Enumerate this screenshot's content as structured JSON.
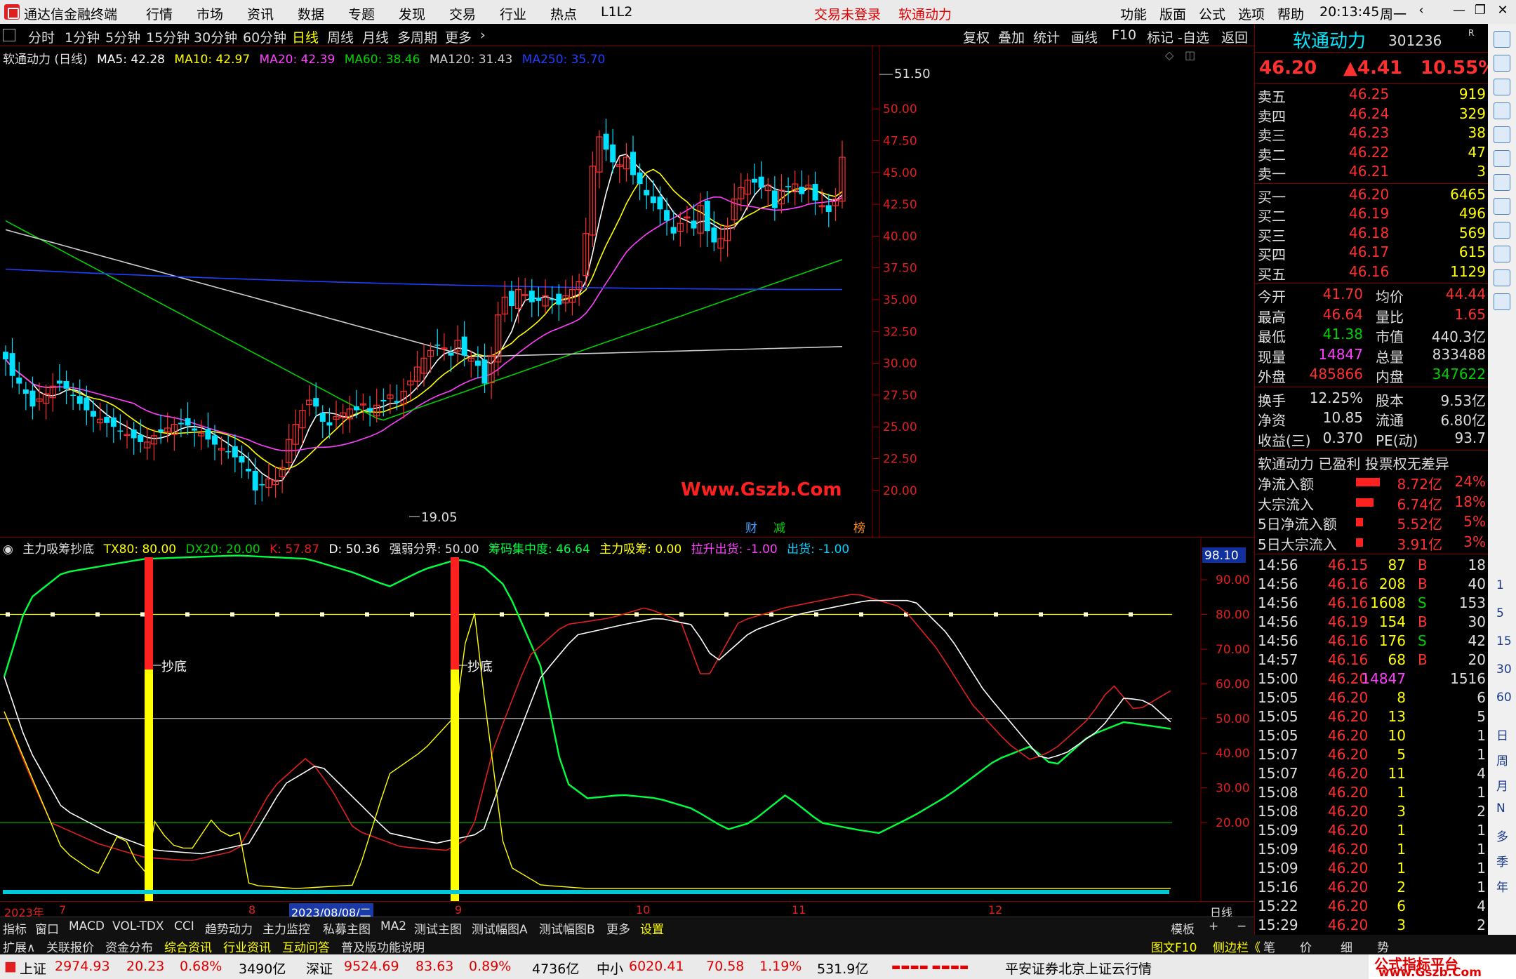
{
  "titlebar": {
    "app_name": "通达信金融终端",
    "menus": [
      "行情",
      "市场",
      "资讯",
      "数据",
      "专题",
      "发现",
      "交易",
      "行业",
      "热点",
      "L1L2"
    ],
    "login_status": "交易未登录",
    "stock_name": "软通动力",
    "right_menus": [
      "功能",
      "版面",
      "公式",
      "选项",
      "帮助"
    ],
    "time": "20:13:45",
    "weekday": "周一"
  },
  "periodbar": {
    "periods": [
      "分时",
      "1分钟",
      "5分钟",
      "15分钟",
      "30分钟",
      "60分钟",
      "日线",
      "周线",
      "月线",
      "多周期",
      "更多"
    ],
    "active": "日线",
    "tools": [
      "复权",
      "叠加",
      "统计",
      "画线",
      "F10",
      "标记",
      "-自选",
      "返回"
    ]
  },
  "main_chart": {
    "legend_title": "软通动力 (日线)",
    "ma": [
      {
        "label": "MA5: 42.28",
        "color": "#ffffff"
      },
      {
        "label": "MA10: 42.97",
        "color": "#ffff00"
      },
      {
        "label": "MA20: 42.39",
        "color": "#ff40ff"
      },
      {
        "label": "MA60: 38.46",
        "color": "#00d000"
      },
      {
        "label": "MA120: 31.43",
        "color": "#cccccc"
      },
      {
        "label": "MA250: 35.70",
        "color": "#2040ff"
      }
    ],
    "y_ticks": [
      "50.00",
      "47.50",
      "45.00",
      "42.50",
      "40.00",
      "37.50",
      "35.00",
      "32.50",
      "30.00",
      "27.50",
      "25.00",
      "22.50",
      "20.00"
    ],
    "high_label": "51.50",
    "low_label": "19.05",
    "watermark": "Www.Gszb.Com",
    "event_marks": [
      {
        "text": "财",
        "color": "#40a0ff"
      },
      {
        "text": "减",
        "color": "#00d000"
      },
      {
        "text": "榜",
        "color": "#ff9020"
      }
    ]
  },
  "sub_chart": {
    "legend": [
      {
        "label": "主力吸筹抄底",
        "color": "#dddddd"
      },
      {
        "label": "TX80: 80.00",
        "color": "#ffff00"
      },
      {
        "label": "DX20: 20.00",
        "color": "#00d000"
      },
      {
        "label": "K: 57.87",
        "color": "#e02020"
      },
      {
        "label": "D: 50.36",
        "color": "#ffffff"
      },
      {
        "label": "强弱分界: 50.00",
        "color": "#dddddd"
      },
      {
        "label": "筹码集中度: 46.64",
        "color": "#00ff40"
      },
      {
        "label": "主力吸筹: 0.00",
        "color": "#ffff00"
      },
      {
        "label": "拉升出货: -1.00",
        "color": "#ff40ff"
      },
      {
        "label": "出货: -1.00",
        "color": "#00d0ff"
      }
    ],
    "y_ticks": [
      "90.00",
      "80.00",
      "70.00",
      "60.00",
      "50.00",
      "40.00",
      "30.00",
      "20.00"
    ],
    "top_value": "98.10",
    "signal_label": "抄底"
  },
  "datebar": {
    "labels": [
      "2023年",
      "7",
      "8",
      "2023/08/08/二",
      "9",
      "10",
      "11",
      "12"
    ],
    "period": "日线"
  },
  "indicator_tabs": [
    "指标",
    "窗口",
    "MACD",
    "VOL-TDX",
    "CCI",
    "趋势动力",
    "主力监控",
    "私募主图",
    "MA2",
    "测试主图",
    "测试幅图A",
    "测试幅图B",
    "更多",
    "设置"
  ],
  "template_btn": "模板",
  "info_tabs": [
    "扩展∧",
    "关联报价",
    "资金分布",
    "综合资讯",
    "行业资讯",
    "互动问答",
    "普及版功能说明"
  ],
  "info_right": [
    "图文F10",
    "侧边栏《",
    "笔",
    "价",
    "细",
    "势"
  ],
  "statusbar": {
    "indices": [
      {
        "name": "上证",
        "value": "2974.93",
        "change": "20.23",
        "pct": "0.68%",
        "amount": "3490亿"
      },
      {
        "name": "深证",
        "value": "9524.69",
        "change": "83.63",
        "pct": "0.89%",
        "amount": "4736亿"
      },
      {
        "name": "中小",
        "value": "6020.41",
        "change": "70.58",
        "pct": "1.19%",
        "amount": "531.9亿"
      }
    ],
    "broker": "平安证券北京上证云行情",
    "watermark": "公式指标平台",
    "watermark_url": "www.Gszb.Com"
  },
  "quote": {
    "name": "软通动力",
    "code": "301236",
    "price": "46.20",
    "change": "▲4.41",
    "pct": "10.55%",
    "sells": [
      {
        "label": "卖五",
        "price": "46.25",
        "vol": "919"
      },
      {
        "label": "卖四",
        "price": "46.24",
        "vol": "329"
      },
      {
        "label": "卖三",
        "price": "46.23",
        "vol": "38"
      },
      {
        "label": "卖二",
        "price": "46.22",
        "vol": "47"
      },
      {
        "label": "卖一",
        "price": "46.21",
        "vol": "3"
      }
    ],
    "buys": [
      {
        "label": "买一",
        "price": "46.20",
        "vol": "6465"
      },
      {
        "label": "买二",
        "price": "46.19",
        "vol": "496"
      },
      {
        "label": "买三",
        "price": "46.18",
        "vol": "569"
      },
      {
        "label": "买四",
        "price": "46.17",
        "vol": "615"
      },
      {
        "label": "买五",
        "price": "46.16",
        "vol": "1129"
      }
    ],
    "stats": [
      {
        "l1": "今开",
        "v1": "41.70",
        "c1": "red",
        "l2": "均价",
        "v2": "44.44",
        "c2": "red"
      },
      {
        "l1": "最高",
        "v1": "46.64",
        "c1": "red",
        "l2": "量比",
        "v2": "1.65",
        "c2": "red"
      },
      {
        "l1": "最低",
        "v1": "41.38",
        "c1": "green",
        "l2": "市值",
        "v2": "440.3亿",
        "c2": "white"
      },
      {
        "l1": "现量",
        "v1": "14847",
        "c1": "magenta",
        "l2": "总量",
        "v2": "833488",
        "c2": "white"
      },
      {
        "l1": "外盘",
        "v1": "485866",
        "c1": "red",
        "l2": "内盘",
        "v2": "347622",
        "c2": "green"
      }
    ],
    "stats2": [
      {
        "l1": "换手",
        "v1": "12.25%",
        "l2": "股本",
        "v2": "9.53亿"
      },
      {
        "l1": "净资",
        "v1": "10.85",
        "l2": "流通",
        "v2": "6.80亿"
      },
      {
        "l1": "收益(三)",
        "v1": "0.370",
        "l2": "PE(动)",
        "v2": "93.7"
      }
    ],
    "tags": "软通动力 已盈利 投票权无差异",
    "flows": [
      {
        "label": "净流入额",
        "value": "8.72亿",
        "pct": "24%",
        "bar": 0.24
      },
      {
        "label": "大宗流入",
        "value": "6.74亿",
        "pct": "18%",
        "bar": 0.18
      },
      {
        "label": "5日净流入额",
        "value": "5.52亿",
        "pct": "5%",
        "bar": 0.05
      },
      {
        "label": "5日大宗流入",
        "value": "3.91亿",
        "pct": "3%",
        "bar": 0.03
      }
    ],
    "ticks": [
      {
        "time": "14:56",
        "price": "46.15",
        "vol": "87",
        "bs": "B",
        "n": "18"
      },
      {
        "time": "14:56",
        "price": "46.16",
        "vol": "208",
        "bs": "B",
        "n": "40"
      },
      {
        "time": "14:56",
        "price": "46.16",
        "vol": "1608",
        "bs": "S",
        "n": "153"
      },
      {
        "time": "14:56",
        "price": "46.19",
        "vol": "154",
        "bs": "B",
        "n": "30"
      },
      {
        "time": "14:56",
        "price": "46.16",
        "vol": "176",
        "bs": "S",
        "n": "42"
      },
      {
        "time": "14:57",
        "price": "46.16",
        "vol": "68",
        "bs": "B",
        "n": "20"
      },
      {
        "time": "15:00",
        "price": "46.20",
        "vol": "14847",
        "bs": "",
        "n": "1516"
      },
      {
        "time": "15:05",
        "price": "46.20",
        "vol": "8",
        "bs": "",
        "n": "6"
      },
      {
        "time": "15:05",
        "price": "46.20",
        "vol": "13",
        "bs": "",
        "n": "5"
      },
      {
        "time": "15:05",
        "price": "46.20",
        "vol": "10",
        "bs": "",
        "n": "1"
      },
      {
        "time": "15:07",
        "price": "46.20",
        "vol": "5",
        "bs": "",
        "n": "1"
      },
      {
        "time": "15:07",
        "price": "46.20",
        "vol": "11",
        "bs": "",
        "n": "4"
      },
      {
        "time": "15:08",
        "price": "46.20",
        "vol": "1",
        "bs": "",
        "n": "1"
      },
      {
        "time": "15:08",
        "price": "46.20",
        "vol": "3",
        "bs": "",
        "n": "2"
      },
      {
        "time": "15:09",
        "price": "46.20",
        "vol": "1",
        "bs": "",
        "n": "1"
      },
      {
        "time": "15:09",
        "price": "46.20",
        "vol": "1",
        "bs": "",
        "n": "1"
      },
      {
        "time": "15:09",
        "price": "46.20",
        "vol": "1",
        "bs": "",
        "n": "1"
      },
      {
        "time": "15:16",
        "price": "46.20",
        "vol": "2",
        "bs": "",
        "n": "1"
      },
      {
        "time": "15:22",
        "price": "46.20",
        "vol": "6",
        "bs": "",
        "n": "4"
      },
      {
        "time": "15:29",
        "price": "46.20",
        "vol": "3",
        "bs": "",
        "n": "2"
      }
    ]
  },
  "iconstrip_chars": [
    "日",
    "周",
    "月",
    "N",
    "多",
    "季",
    "年"
  ],
  "iconstrip_nums": [
    "1",
    "5",
    "15",
    "30",
    "60"
  ]
}
